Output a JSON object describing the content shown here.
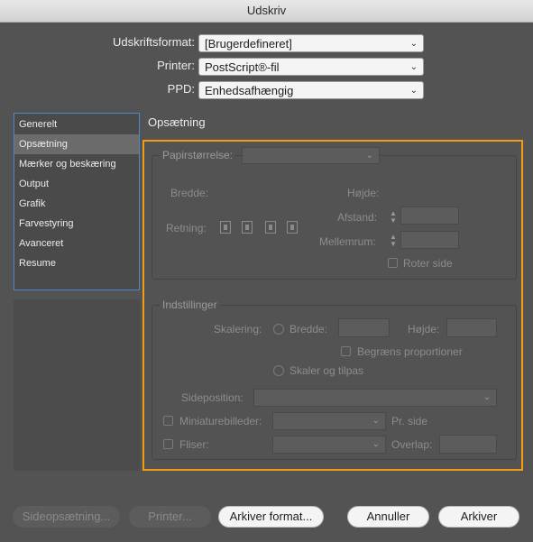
{
  "window": {
    "title": "Udskriv"
  },
  "header": {
    "format_label": "Udskriftsformat:",
    "format_value": "[Brugerdefineret]",
    "printer_label": "Printer:",
    "printer_value": "PostScript®-fil",
    "ppd_label": "PPD:",
    "ppd_value": "Enhedsafhængig"
  },
  "sidebar": {
    "items": [
      {
        "label": "Generelt"
      },
      {
        "label": "Opsætning"
      },
      {
        "label": "Mærker og beskæring"
      },
      {
        "label": "Output"
      },
      {
        "label": "Grafik"
      },
      {
        "label": "Farvestyring"
      },
      {
        "label": "Avanceret"
      },
      {
        "label": "Resume"
      }
    ],
    "selected": "Opsætning"
  },
  "section_title": "Opsætning",
  "paper": {
    "size_label": "Papirstørrelse:",
    "size_value": "",
    "width_label": "Bredde:",
    "height_label": "Højde:",
    "orientation_label": "Retning:",
    "offset_label": "Afstand:",
    "gap_label": "Mellemrum:",
    "rotate_label": "Roter side"
  },
  "settings": {
    "title": "Indstillinger",
    "scaling_label": "Skalering:",
    "width_label": "Bredde:",
    "height_label": "Højde:",
    "constrain_label": "Begræns proportioner",
    "fit_label": "Skaler og tilpas",
    "position_label": "Sideposition:",
    "position_value": "",
    "thumbs_label": "Miniaturebilleder:",
    "thumbs_value": "",
    "per_page_label": "Pr. side",
    "tiles_label": "Fliser:",
    "tiles_value": "",
    "overlap_label": "Overlap:"
  },
  "footer": {
    "page_setup": "Sideopsætning...",
    "printer": "Printer...",
    "save_preset": "Arkiver format...",
    "cancel": "Annuller",
    "save": "Arkiver"
  },
  "accent_color": "#f39c12",
  "selection_color": "#4f88c6",
  "icons": {
    "chevron": "chevron-down-icon",
    "spinner": "stepper-icon",
    "orientation": "page-orientation-icon"
  }
}
